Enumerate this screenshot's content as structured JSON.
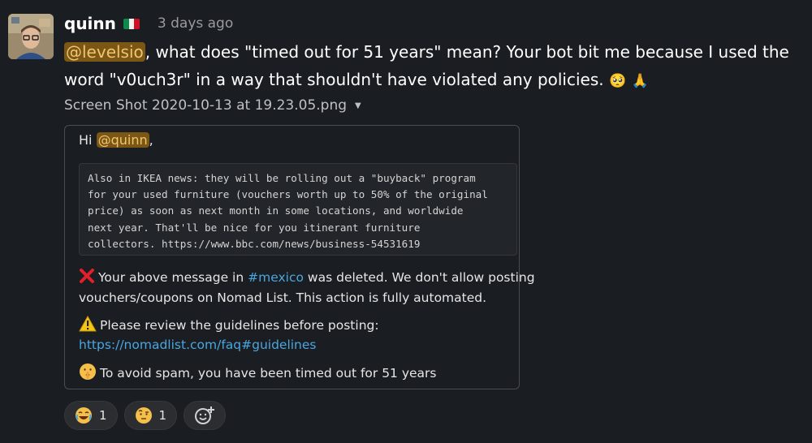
{
  "message": {
    "username": "quinn",
    "timestamp": "3 days ago",
    "mention": "@levelsio",
    "text_line1": ", what does \"timed out for 51 years\" mean? Your bot bit me because I used the",
    "text_line2": "word \"v0uch3r\" in a way that shouldn't have violated any policies.",
    "emoji_icons": [
      "pleading-face-icon",
      "folded-hands-icon"
    ]
  },
  "attachment": {
    "filename": "Screen Shot 2020-10-13 at 19.23.05.png",
    "greeting_prefix": "Hi",
    "greeting_mention": "@quinn",
    "greeting_suffix": ",",
    "quoted_message": "Also in IKEA news: they will be rolling out a \"buyback\" program\nfor your used furniture (vouchers worth up to 50% of the original\nprice) as soon as next month in some locations, and worldwide\nnext year. That'll be nice for you itinerant furniture\ncollectors. https://www.bbc.com/news/business-54531619",
    "deleted_prefix": "Your above message in",
    "deleted_channel": "#mexico",
    "deleted_suffix": "was deleted. We don't allow posting",
    "deleted_line2": "vouchers/coupons on Nomad List. This action is fully automated.",
    "guidelines_text": "Please review the guidelines before posting:",
    "guidelines_link": "https://nomadlist.com/faq#guidelines",
    "timeout_text": "To avoid spam, you have been timed out for 51 years"
  },
  "reactions": [
    {
      "icon": "joy-icon",
      "count": "1"
    },
    {
      "icon": "raised-eyebrow-icon",
      "count": "1"
    }
  ],
  "colors": {
    "background": "#1a1d21",
    "mention_bg": "#7a5714",
    "mention_text": "#f3c46f",
    "link": "#4aa6e0"
  }
}
